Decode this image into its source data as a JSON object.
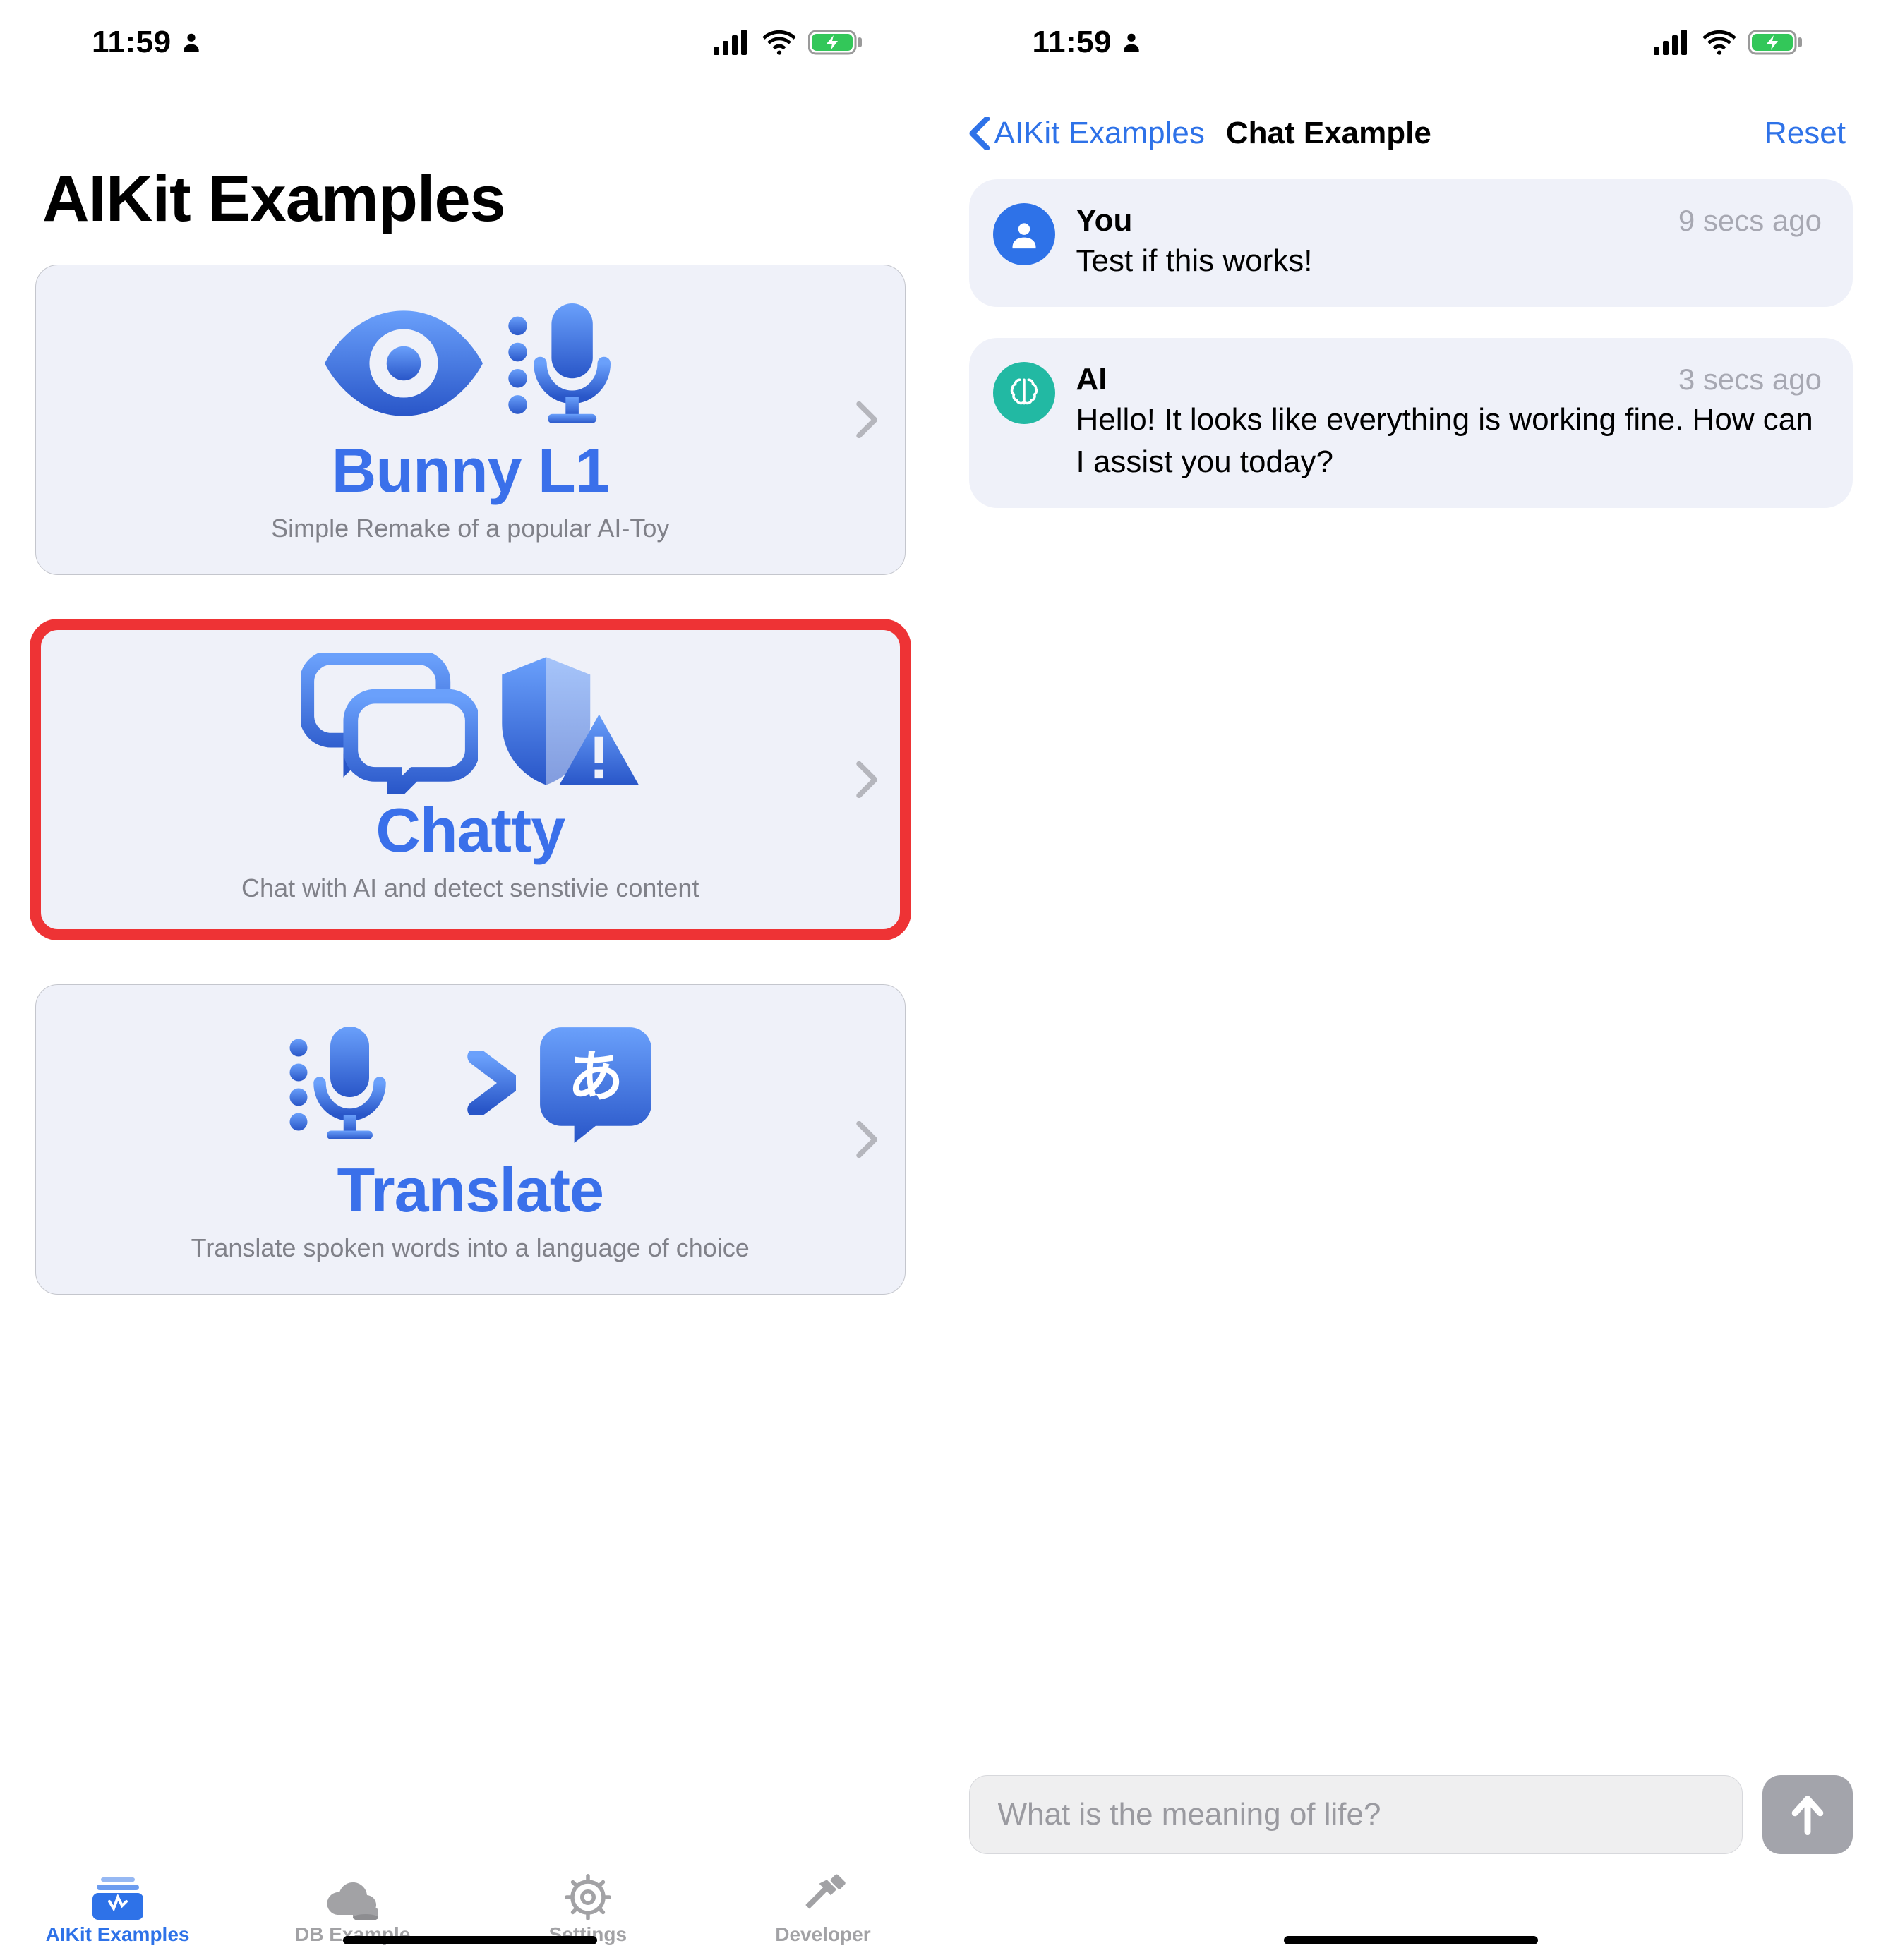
{
  "status": {
    "time": "11:59",
    "signal_bars": 4,
    "battery_charging": true
  },
  "left": {
    "title": "AIKit Examples",
    "examples": [
      {
        "title": "Bunny L1",
        "subtitle": "Simple Remake of a popular AI-Toy",
        "icons": [
          "eye",
          "dots-mic"
        ],
        "highlighted": false
      },
      {
        "title": "Chatty",
        "subtitle": "Chat with AI and detect senstivie content",
        "icons": [
          "bubbles",
          "shield-warn"
        ],
        "highlighted": true
      },
      {
        "title": "Translate",
        "subtitle": "Translate spoken words into a language of choice",
        "icons": [
          "dots-mic",
          "arrow-right",
          "lang-tile"
        ],
        "highlighted": false
      }
    ],
    "tabs": [
      {
        "label": "AIKit Examples",
        "icon": "stack",
        "active": true
      },
      {
        "label": "DB Example",
        "icon": "cloud-db",
        "active": false
      },
      {
        "label": "Settings",
        "icon": "gear",
        "active": false
      },
      {
        "label": "Developer",
        "icon": "hammer",
        "active": false
      }
    ]
  },
  "right": {
    "nav": {
      "back_label": "AIKit Examples",
      "title": "Chat Example",
      "right_label": "Reset"
    },
    "messages": [
      {
        "sender": "You",
        "avatar": "you",
        "time": "9 secs ago",
        "text": "Test if this works!"
      },
      {
        "sender": "AI",
        "avatar": "ai",
        "time": "3 secs ago",
        "text": "Hello! It looks like everything is working fine. How can I assist you today?"
      }
    ],
    "input_placeholder": "What is the meaning of life?"
  }
}
